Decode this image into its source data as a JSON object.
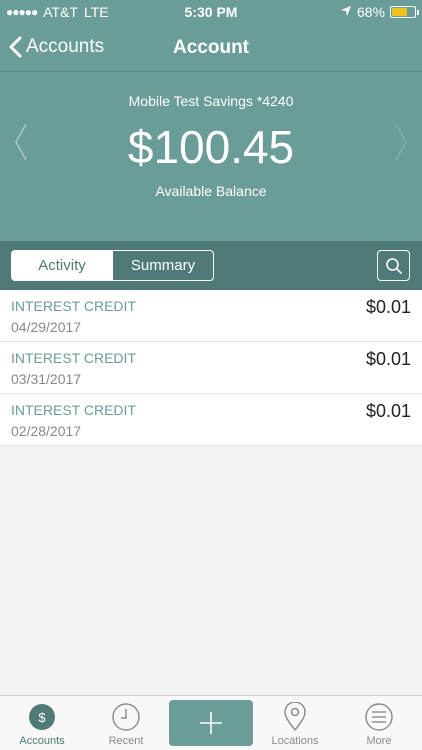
{
  "status_bar": {
    "carrier": "AT&T",
    "network": "LTE",
    "time": "5:30 PM",
    "battery": "68%",
    "battery_level": 0.68,
    "battery_color": "#f2c01e"
  },
  "nav": {
    "back_label": "Accounts",
    "title": "Account"
  },
  "account": {
    "name": "Mobile Test Savings *4240",
    "balance": "$100.45",
    "balance_label": "Available Balance"
  },
  "segments": {
    "activity": "Activity",
    "summary": "Summary",
    "selected": "Activity"
  },
  "transactions": [
    {
      "description": "INTEREST CREDIT",
      "date": "04/29/2017",
      "amount": "$0.01"
    },
    {
      "description": "INTEREST CREDIT",
      "date": "03/31/2017",
      "amount": "$0.01"
    },
    {
      "description": "INTEREST CREDIT",
      "date": "02/28/2017",
      "amount": "$0.01"
    }
  ],
  "tabs": [
    {
      "label": "Accounts",
      "icon": "dollar-icon",
      "active": true
    },
    {
      "label": "Recent",
      "icon": "clock-icon",
      "active": false
    },
    {
      "label": "",
      "icon": "plus-icon",
      "active": false
    },
    {
      "label": "Locations",
      "icon": "location-pin-icon",
      "active": false
    },
    {
      "label": "More",
      "icon": "menu-icon",
      "active": false
    }
  ],
  "colors": {
    "header": "#6a9c98",
    "segment_bar": "#4f7a76",
    "accent_text": "#6a9c98"
  }
}
